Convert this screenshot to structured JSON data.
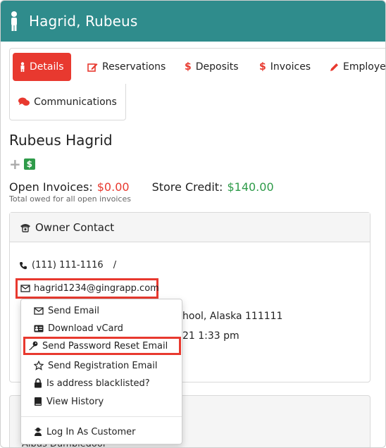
{
  "header": {
    "title": "Hagrid, Rubeus"
  },
  "tabs": [
    {
      "label": "Details",
      "icon": "person-icon",
      "active": true
    },
    {
      "label": "Reservations",
      "icon": "edit-icon"
    },
    {
      "label": "Deposits",
      "icon": "dollar-icon"
    },
    {
      "label": "Invoices",
      "icon": "dollar-icon"
    },
    {
      "label": "Employee",
      "icon": "pencil-icon"
    },
    {
      "label": "Communications",
      "icon": "comments-icon"
    }
  ],
  "customer": {
    "name": "Rubeus Hagrid",
    "open_invoices_label": "Open Invoices:",
    "open_invoices_value": "$0.00",
    "store_credit_label": "Store Credit:",
    "store_credit_value": "$140.00",
    "note": "Total owed for all open invoices"
  },
  "owner_contact": {
    "title": "Owner Contact",
    "phone": "(111) 111-1116",
    "phone_sep": "/",
    "email": "hagrid1234@gingrapp.com",
    "address": "hool, Alaska 111111",
    "date": "21 1:33 pm"
  },
  "menu": {
    "items": [
      {
        "label": "Send Email",
        "icon": "envelope-icon"
      },
      {
        "label": "Download vCard",
        "icon": "vcard-icon"
      },
      {
        "label": "Send Password Reset Email",
        "icon": "key-icon"
      },
      {
        "label": "Send Registration Email",
        "icon": "star-icon"
      },
      {
        "label": "Is address blacklisted?",
        "icon": "lock-icon"
      },
      {
        "label": "View History",
        "icon": "book-icon"
      },
      {
        "label": "Log In As Customer",
        "icon": "user-secret-icon"
      }
    ]
  },
  "second_panel": {
    "text": "Albus Dumbledoor"
  },
  "colors": {
    "header": "#2f8c8c",
    "accent": "#e8392f",
    "green": "#2e9b49"
  }
}
